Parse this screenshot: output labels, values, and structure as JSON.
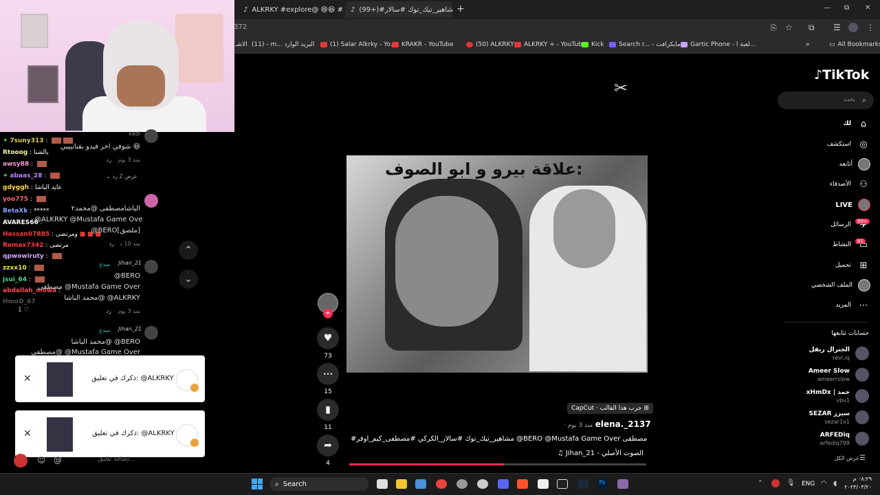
{
  "browser": {
    "tabs": [
      {
        "label": "ALKRKY #explore@ 😄😆 #اک",
        "active": false
      },
      {
        "label": "(99+)#مشاهير_تيك_توك #سالار...",
        "active": true
      }
    ],
    "new_tab": "+",
    "url": "372",
    "window_controls": [
      "—",
      "⧉",
      "✕"
    ],
    "bookmarks": [
      "الاشـ",
      "(11) - m... البريد الوارد",
      "(1) Salar Alkrky - Yo...",
      "KRAKR - YouTube",
      "(50) ALKRKY",
      "ALKRKY + - YouTube",
      "Kick",
      "Search r... - مايكرافت",
      "Gartic Phone - لعبة ا...",
      "»",
      "All Bookmarks"
    ]
  },
  "live_chat": [
    {
      "name": "7suny313",
      "msg": ""
    },
    {
      "name": "Rtooog",
      "msg": "يالشنا"
    },
    {
      "name": "awsy88",
      "msg": ""
    },
    {
      "name": "abaas_28",
      "msg": ""
    },
    {
      "name": "gdyggh",
      "msg": "عايد الباشا"
    },
    {
      "name": "yoo775",
      "msg": ""
    },
    {
      "name": "BetaXk",
      "msg": "*****"
    },
    {
      "name": "AVARES66",
      "msg": ""
    },
    {
      "name": "Hassan07885",
      "msg": "ومرتضى"
    },
    {
      "name": "Remax7342",
      "msg": "مرتضى"
    },
    {
      "name": "qpwowiruty",
      "msg": ""
    },
    {
      "name": "zzxx10",
      "msg": ""
    },
    {
      "name": "jsui_64",
      "msg": ""
    },
    {
      "name": "abdallah_mowa",
      "msg": ""
    },
    {
      "name": "HmoD_67",
      "msg": ""
    }
  ],
  "comments": {
    "c1": {
      "user": "kadi",
      "text": "شوفي اخر فيدو بقنانييبي 😆",
      "meta": "منذ 3 يوم",
      "reply": "رد",
      "likes": ""
    },
    "view_replies": "عرض 2 رد",
    "c2": {
      "text1": "الباشامصطفى @محمد٢",
      "text2": "@ALKRKY @Mustafa Game Ove",
      "text3": "@BERO[ملصق]",
      "meta": "منذ 10 د",
      "reply": "رد"
    },
    "c3": {
      "user": "Jihan_21",
      "badge": "مبدع",
      "text1": "@BERO",
      "text2": "مصطفى @Mustafa Game Over",
      "text3": "محمد الباشا@ @ALKRKY",
      "meta": "منذ 3 يوم",
      "reply": "رد",
      "likes": "1"
    },
    "c4": {
      "user": "Jihan_21",
      "badge": "مبدع",
      "text1": "محمد الباشا@ @BERO",
      "text2": "مصطفى@ @Mustafa Game Over"
    },
    "add_comment": "إضافة تعليق..."
  },
  "notifications": [
    {
      "text": "ذكرك في تعليق: @ALKRKY a",
      "close": "✕"
    },
    {
      "text": "ذكرك في تعليق: @ALKRKY s",
      "close": "✕"
    }
  ],
  "video": {
    "caption": "علاقة بيرو و ابو الصوف:",
    "capcut_tag": "CapCut · جرب هذا القالب",
    "author": "elena._2137",
    "time_ago": "· منذ 3 يوم",
    "description": "#مشاهير_تيك_توك #سالار_الكركي #مصطفى_كيم_اوفر @BERO @Mustafa Game Over مصطفى",
    "sound": "♫ Jihan_21 - الصوت الأصلي",
    "progress": 0.52
  },
  "actions": [
    {
      "icon": "heart-icon",
      "glyph": "♥",
      "count": "73"
    },
    {
      "icon": "comment-icon",
      "glyph": "•••",
      "count": "15"
    },
    {
      "icon": "bookmark-icon",
      "glyph": "▮",
      "count": "11"
    },
    {
      "icon": "share-icon",
      "glyph": "➦",
      "count": "4"
    }
  ],
  "tiktok": {
    "logo": "TikTok",
    "search_placeholder": "بحث",
    "nav": [
      {
        "label": "لك",
        "icon": "home-icon",
        "glyph": "⌂"
      },
      {
        "label": "استكشف",
        "icon": "compass-icon",
        "glyph": "◎"
      },
      {
        "label": "أتابعه",
        "icon": "following-avatar-icon",
        "glyph": ""
      },
      {
        "label": "الأصدقاء",
        "icon": "friends-icon",
        "glyph": "⚇"
      },
      {
        "label": "LIVE",
        "icon": "live-avatar-icon",
        "glyph": ""
      },
      {
        "label": "الرسائل",
        "icon": "messages-icon",
        "glyph": "✈",
        "badge": "99+"
      },
      {
        "label": "النشاط",
        "icon": "activity-icon",
        "glyph": "▭",
        "badge": "61"
      },
      {
        "label": "تحميل",
        "icon": "upload-icon",
        "glyph": "⊞"
      },
      {
        "label": "الملف الشخصي",
        "icon": "profile-avatar-icon",
        "glyph": ""
      },
      {
        "label": "المزيد",
        "icon": "more-icon",
        "glyph": "⋯"
      }
    ],
    "following_title": "حسابات تتابعها",
    "following": [
      {
        "name": "الجنرال ريقل",
        "handle": "revl.iq"
      },
      {
        "name": "Ameer Slow",
        "handle": "ameerrslow"
      },
      {
        "name": "xHmDx | حمد",
        "handle": "vbv1"
      },
      {
        "name": "SEZAR سيزر",
        "handle": "sezar1x1"
      },
      {
        "name": "ARFEDiq",
        "handle": "arfediq799"
      }
    ],
    "see_all": "عرض الكل"
  },
  "taskbar": {
    "search": "Search",
    "lang": "ENG",
    "time": "٠٨:٢٩ م",
    "date": "٢٠٢٣/٠٣/٢٠"
  }
}
